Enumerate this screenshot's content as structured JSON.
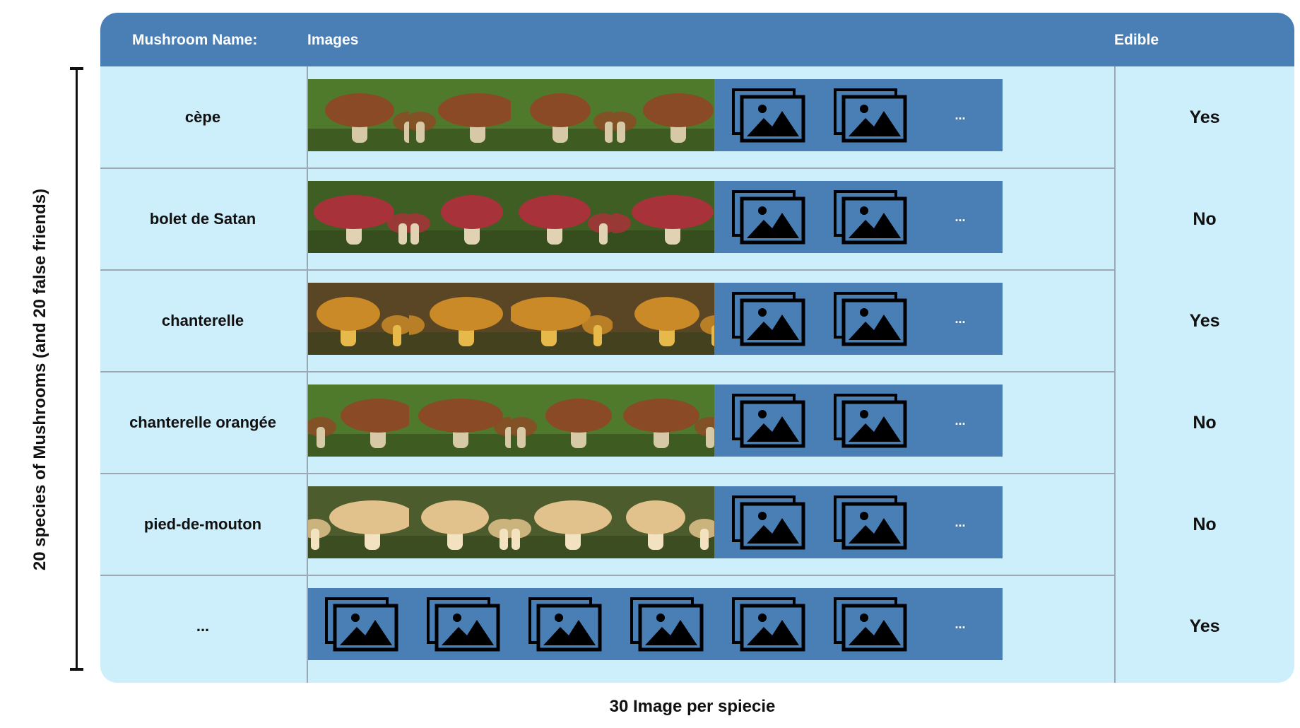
{
  "header": {
    "name_label": "Mushroom Name:",
    "images_label": "Images",
    "edible_label": "Edible"
  },
  "side_label": "20 species of Mushrooms (and 20 false friends)",
  "bottom_label": "30 Image per spiecie",
  "ellipsis": "...",
  "rows": [
    {
      "name": "cèpe",
      "edible": "Yes",
      "photos": [
        "mushroom-photo",
        "mushroom-photo",
        "mushroom-photo",
        "mushroom-photo"
      ]
    },
    {
      "name": "bolet de Satan",
      "edible": "No",
      "photos": [
        "mushroom-photo",
        "mushroom-photo",
        "mushroom-photo",
        "mushroom-photo"
      ]
    },
    {
      "name": "chanterelle",
      "edible": "Yes",
      "photos": [
        "mushroom-photo",
        "mushroom-photo",
        "mushroom-photo",
        "mushroom-photo"
      ]
    },
    {
      "name": "chanterelle orangée",
      "edible": "No",
      "photos": [
        "mushroom-photo",
        "mushroom-photo",
        "mushroom-photo",
        "mushroom-photo"
      ]
    },
    {
      "name": "pied-de-mouton",
      "edible": "No",
      "photos": [
        "mushroom-photo",
        "mushroom-photo",
        "mushroom-photo",
        "mushroom-photo"
      ]
    },
    {
      "name": "...",
      "edible": "Yes",
      "photos": []
    }
  ],
  "colors": {
    "header_bg": "#4a7fb6",
    "card_bg": "#cdeefb",
    "placeholder_bg": "#4a7fb6"
  },
  "icons": {
    "placeholder": "image-placeholder-icon"
  }
}
